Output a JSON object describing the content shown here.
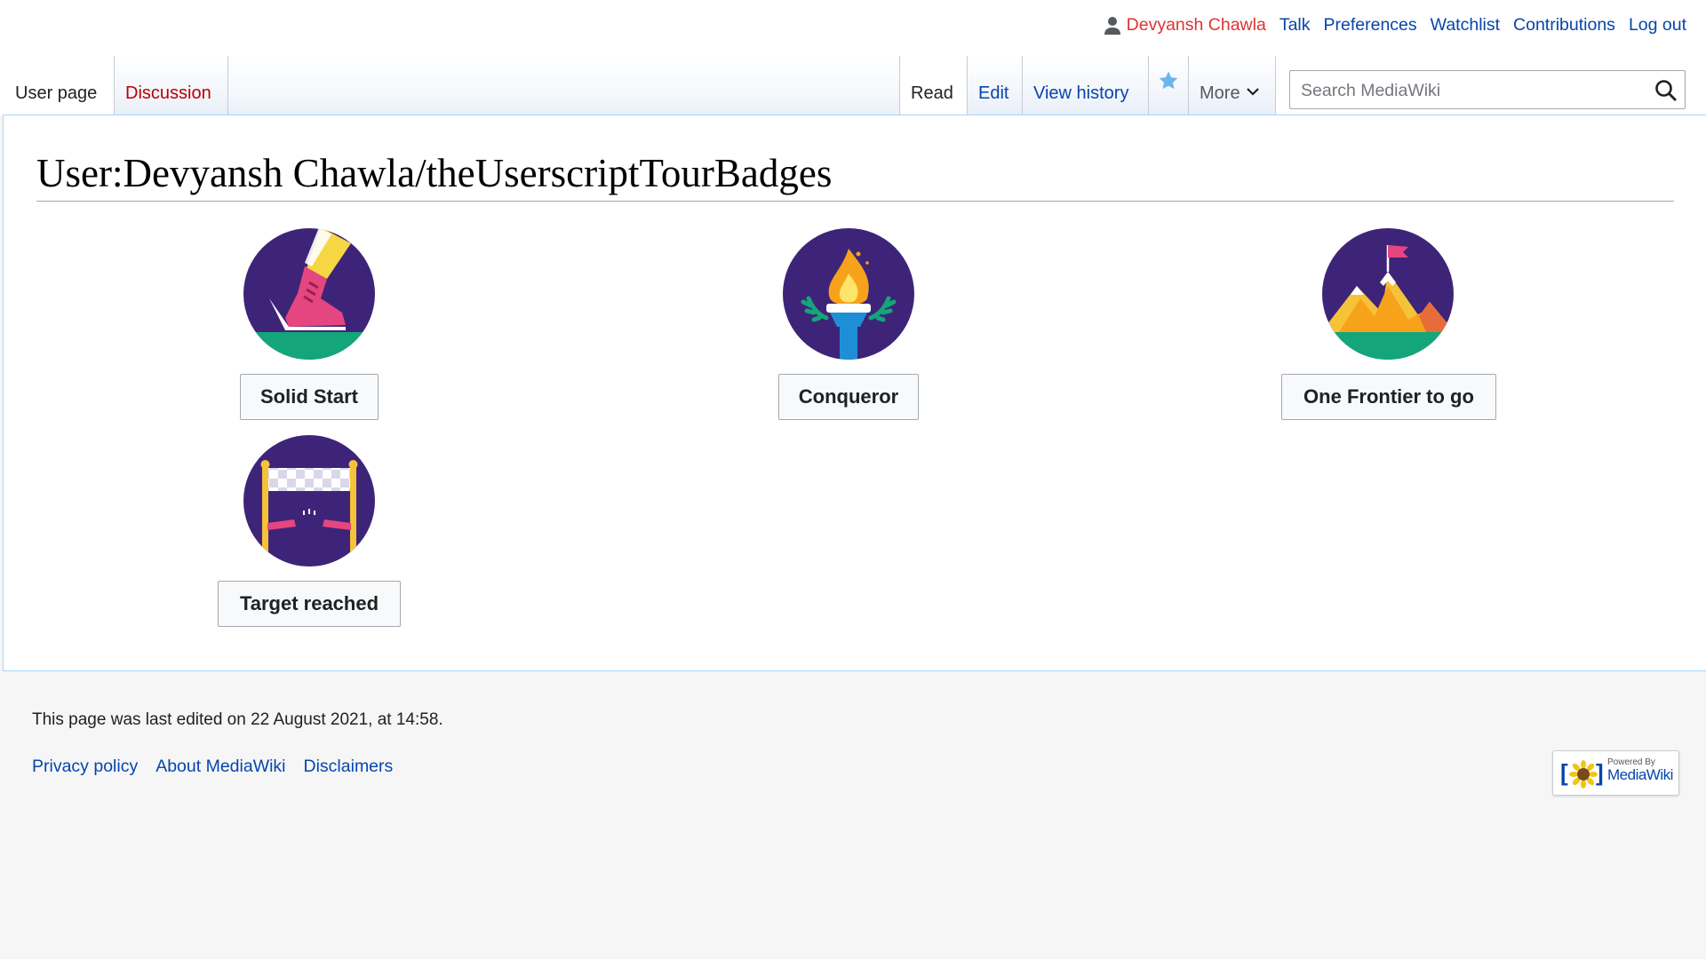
{
  "personal_tools": {
    "username": "Devyansh Chawla",
    "talk": "Talk",
    "preferences": "Preferences",
    "watchlist": "Watchlist",
    "contributions": "Contributions",
    "logout": "Log out"
  },
  "namespace_tabs": [
    {
      "label": "User page",
      "selected": true
    },
    {
      "label": "Discussion",
      "redlink": true
    }
  ],
  "view_tabs": [
    {
      "label": "Read",
      "selected": true
    },
    {
      "label": "Edit"
    },
    {
      "label": "View history"
    },
    {
      "label": "More"
    }
  ],
  "icons": {
    "user": "user-icon",
    "watch": "star-icon",
    "more": "chevron-down-icon",
    "search": "search-icon"
  },
  "search": {
    "placeholder": "Search MediaWiki"
  },
  "page": {
    "title": "User:Devyansh Chawla/theUserscriptTourBadges"
  },
  "badges": [
    {
      "label": "Solid Start",
      "icon": "sneaker-badge-icon"
    },
    {
      "label": "Conqueror",
      "icon": "torch-badge-icon"
    },
    {
      "label": "One Frontier to go",
      "icon": "mountain-flag-badge-icon"
    },
    {
      "label": "Target reached",
      "icon": "finish-line-badge-icon"
    }
  ],
  "footer": {
    "last_edited": "This page was last edited on 22 August 2021, at 14:58.",
    "links": [
      "Privacy policy",
      "About MediaWiki",
      "Disclaimers"
    ],
    "powered_small": "Powered By",
    "powered_big": "MediaWiki"
  },
  "colors": {
    "link": "#0645ad",
    "redlink": "#d33",
    "badge_purple": "#3e2478",
    "badge_green": "#14a57b",
    "border_blue": "#a7d7f9"
  }
}
